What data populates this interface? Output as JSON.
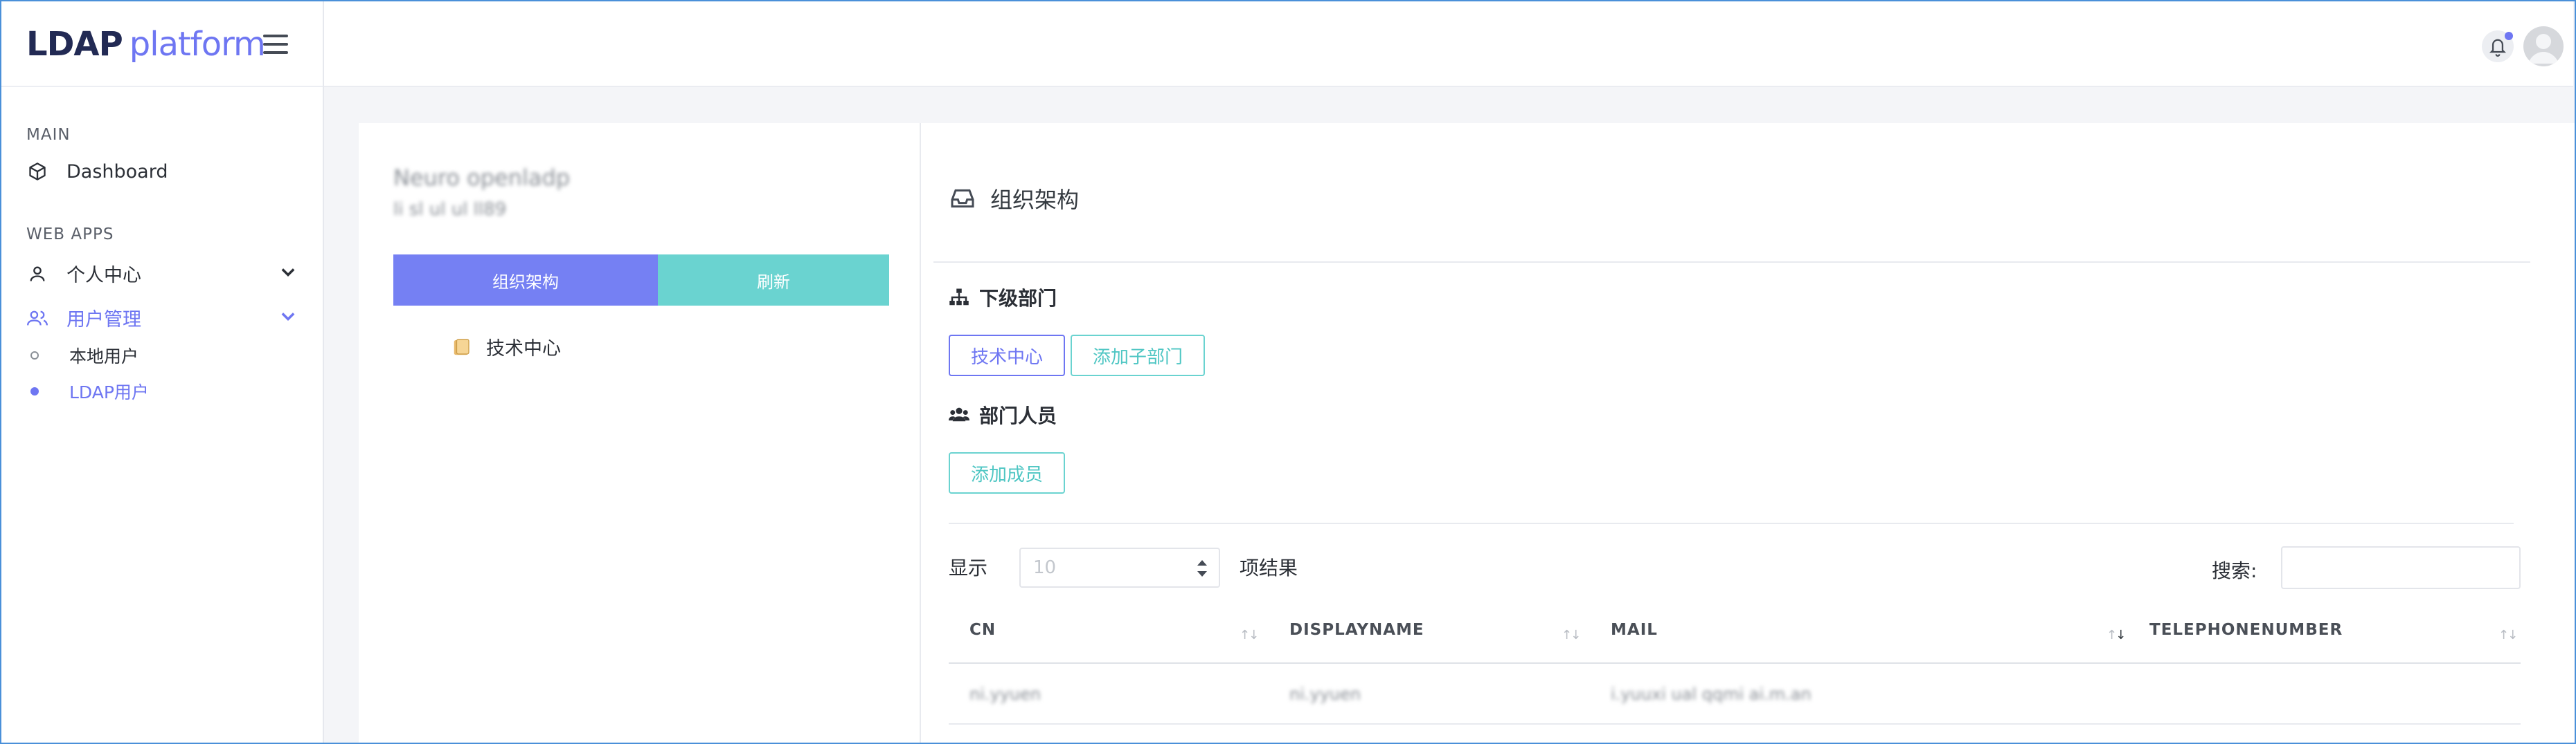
{
  "app": {
    "brand_bold": "LDAP",
    "brand_light": "platform"
  },
  "sidebar": {
    "sections": [
      {
        "title": "MAIN"
      },
      {
        "title": "WEB APPS"
      }
    ],
    "items": [
      {
        "label": "Dashboard",
        "icon": "cube-icon"
      },
      {
        "label": "个人中心",
        "icon": "user-icon"
      },
      {
        "label": "用户管理",
        "icon": "users-icon"
      }
    ],
    "sub_items": [
      {
        "label": "本地用户"
      },
      {
        "label": "LDAP用户"
      }
    ],
    "accent_color": "#6e76f2"
  },
  "left": {
    "ou_name": "Neuro openladp",
    "ou_sub": "li sl ul ul ll89",
    "btn_org": "组织架构",
    "btn_refresh": "刷新",
    "tree_item": "技术中心"
  },
  "main": {
    "title": "组织架构",
    "sub_dept_title": "下级部门",
    "dept_button": "技术中心",
    "add_sub_dept": "添加子部门",
    "members_title": "部门人员",
    "add_member": "添加成员",
    "show_label": "显示",
    "page_size": "10",
    "results_label": "项结果",
    "search_label": "搜索:",
    "table": {
      "columns": [
        "CN",
        "DISPLAYNAME",
        "MAIL",
        "TELEPHONENUMBER"
      ],
      "rows": [
        {
          "cn": "ni.yyuen",
          "displayname": "ni.yyuen",
          "mail": "i.yuuxi ual qqmi ai.m.an",
          "tel": ""
        }
      ]
    }
  }
}
